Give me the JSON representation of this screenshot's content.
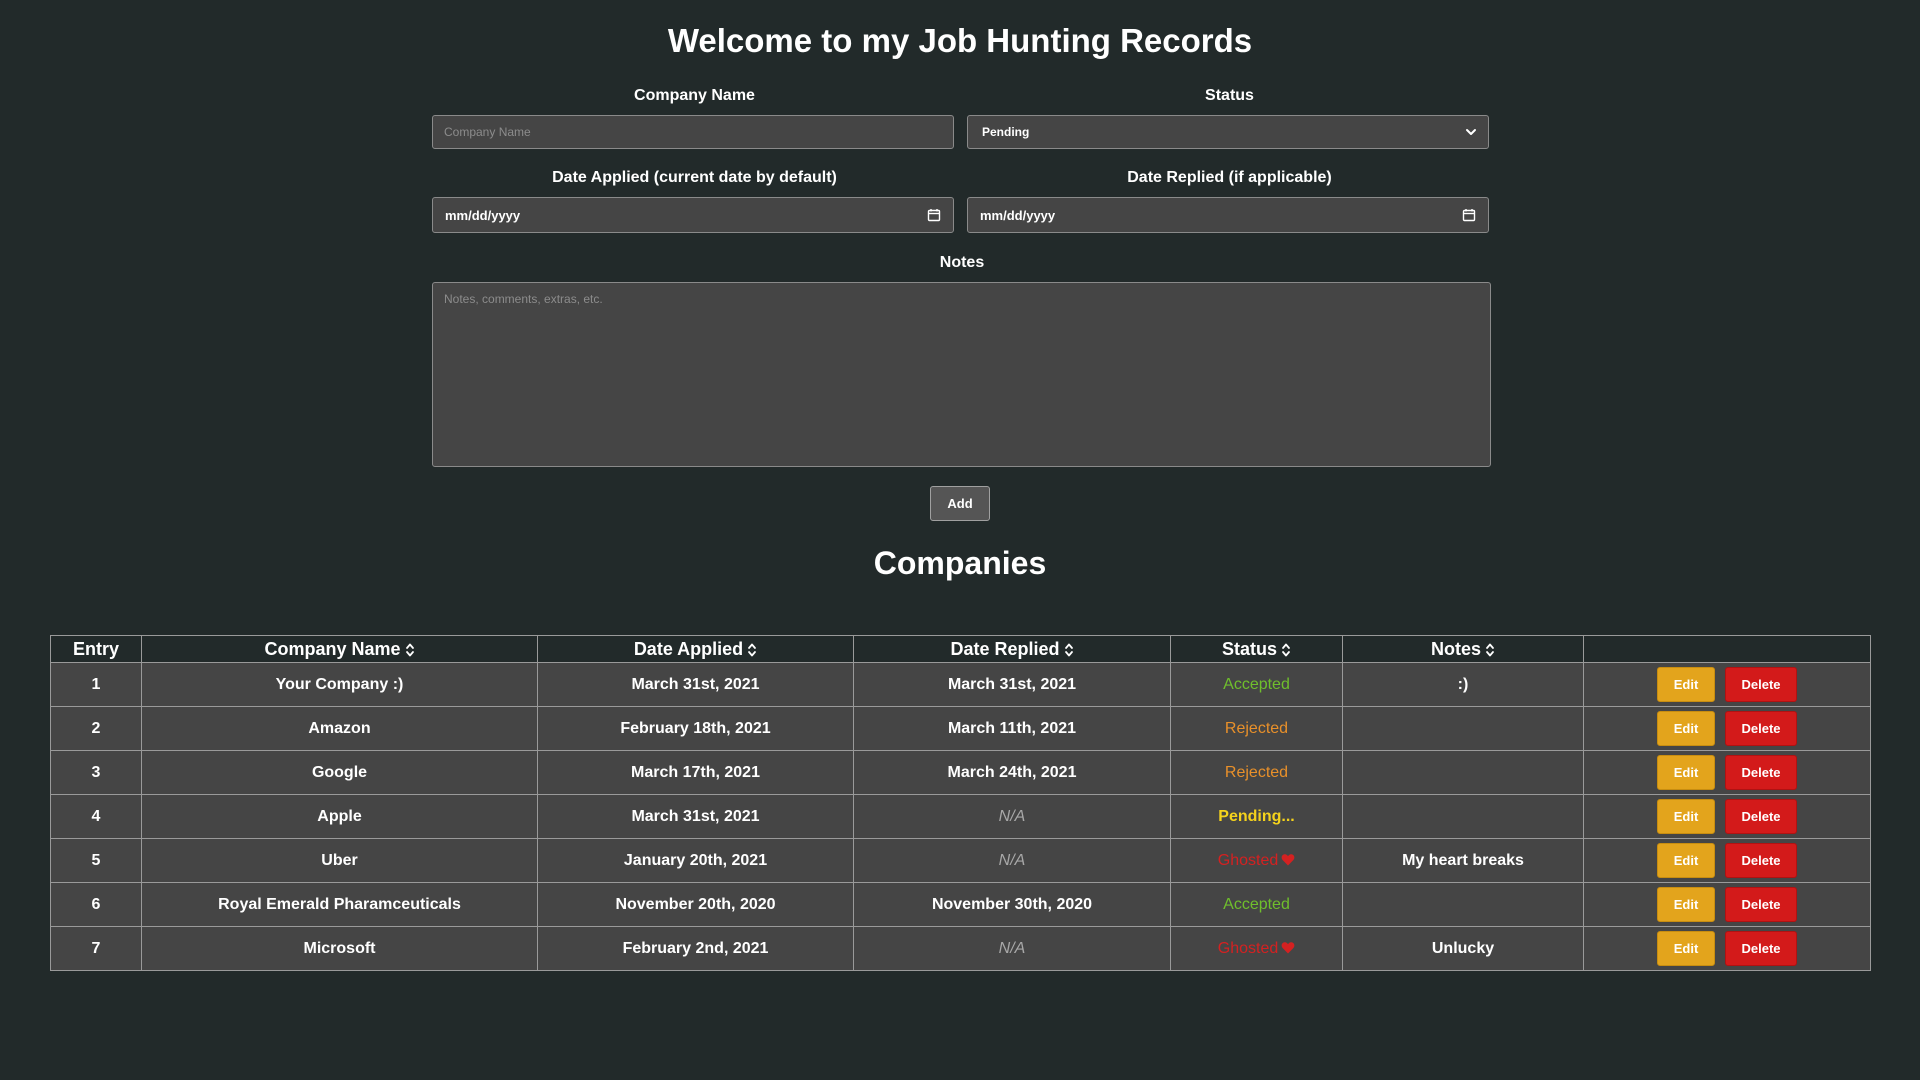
{
  "page": {
    "title": "Welcome to my Job Hunting Records"
  },
  "form": {
    "company_name_label": "Company Name",
    "company_name_placeholder": "Company Name",
    "status_label": "Status",
    "status_value": "Pending",
    "date_applied_label": "Date Applied (current date by default)",
    "date_applied_value": "mm/dd/yyyy",
    "date_replied_label": "Date Replied (if applicable)",
    "date_replied_value": "mm/dd/yyyy",
    "notes_label": "Notes",
    "notes_placeholder": "Notes, comments, extras, etc.",
    "add_label": "Add"
  },
  "companies": {
    "title": "Companies",
    "headers": {
      "entry": "Entry",
      "company": "Company Name",
      "applied": "Date Applied",
      "replied": "Date Replied",
      "status": "Status",
      "notes": "Notes"
    },
    "edit_label": "Edit",
    "delete_label": "Delete",
    "status_colors": {
      "accepted": "#6fbf2c",
      "rejected": "#e8902a",
      "pending": "#f4d21c",
      "ghosted": "#d42121"
    },
    "rows": [
      {
        "entry": "1",
        "company": "Your Company :)",
        "applied": "March 31st, 2021",
        "replied": "March 31st, 2021",
        "status": "Accepted",
        "status_type": "accepted",
        "notes": ":)"
      },
      {
        "entry": "2",
        "company": "Amazon",
        "applied": "February 18th, 2021",
        "replied": "March 11th, 2021",
        "status": "Rejected",
        "status_type": "rejected",
        "notes": ""
      },
      {
        "entry": "3",
        "company": "Google",
        "applied": "March 17th, 2021",
        "replied": "March 24th, 2021",
        "status": "Rejected",
        "status_type": "rejected",
        "notes": ""
      },
      {
        "entry": "4",
        "company": "Apple",
        "applied": "March 31st, 2021",
        "replied": "N/A",
        "status": "Pending...",
        "status_type": "pending",
        "notes": ""
      },
      {
        "entry": "5",
        "company": "Uber",
        "applied": "January 20th, 2021",
        "replied": "N/A",
        "status": "Ghosted",
        "status_type": "ghosted",
        "notes": "My heart breaks"
      },
      {
        "entry": "6",
        "company": "Royal Emerald Pharamceuticals",
        "applied": "November 20th, 2020",
        "replied": "November 30th, 2020",
        "status": "Accepted",
        "status_type": "accepted",
        "notes": ""
      },
      {
        "entry": "7",
        "company": "Microsoft",
        "applied": "February 2nd, 2021",
        "replied": "N/A",
        "status": "Ghosted",
        "status_type": "ghosted",
        "notes": "Unlucky"
      }
    ]
  }
}
